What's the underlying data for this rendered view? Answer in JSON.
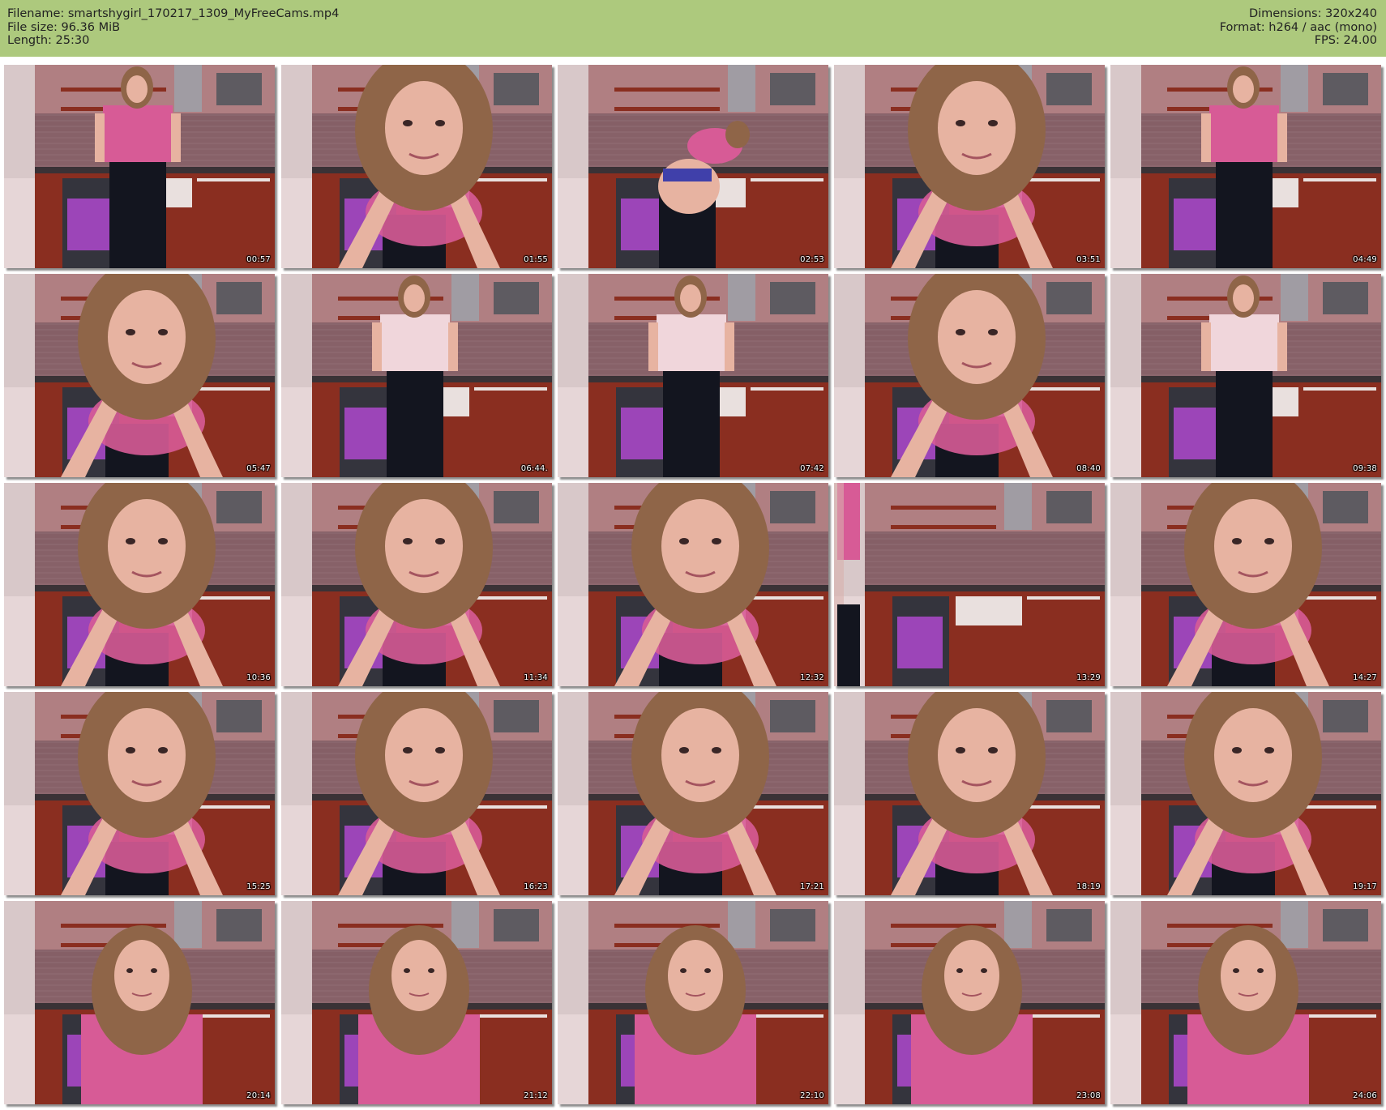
{
  "header": {
    "filename": "Filename: smartshygirl_170217_1309_MyFreeCams.mp4",
    "filesize": "File size: 96.36 MiB",
    "length": "Length: 25:30",
    "dimensions": "Dimensions: 320x240",
    "format": "Format: h264 / aac (mono)",
    "fps": "FPS: 24.00"
  },
  "thumbnails": [
    {
      "time": "00:57",
      "pose": "standing"
    },
    {
      "time": "01:55",
      "pose": "closeup"
    },
    {
      "time": "02:53",
      "pose": "bent"
    },
    {
      "time": "03:51",
      "pose": "closeup"
    },
    {
      "time": "04:49",
      "pose": "standing"
    },
    {
      "time": "05:47",
      "pose": "closeup"
    },
    {
      "time": "06:44.",
      "pose": "back"
    },
    {
      "time": "07:42",
      "pose": "back"
    },
    {
      "time": "08:40",
      "pose": "closeup"
    },
    {
      "time": "09:38",
      "pose": "back"
    },
    {
      "time": "10:36",
      "pose": "closeup"
    },
    {
      "time": "11:34",
      "pose": "closeup"
    },
    {
      "time": "12:32",
      "pose": "closeup"
    },
    {
      "time": "13:29",
      "pose": "empty"
    },
    {
      "time": "14:27",
      "pose": "closeup"
    },
    {
      "time": "15:25",
      "pose": "closeup"
    },
    {
      "time": "16:23",
      "pose": "closeup"
    },
    {
      "time": "17:21",
      "pose": "closeup"
    },
    {
      "time": "18:19",
      "pose": "closeup"
    },
    {
      "time": "19:17",
      "pose": "closeup"
    },
    {
      "time": "20:14",
      "pose": "seated"
    },
    {
      "time": "21:12",
      "pose": "seated"
    },
    {
      "time": "22:10",
      "pose": "seated"
    },
    {
      "time": "23:08",
      "pose": "seated"
    },
    {
      "time": "24:06",
      "pose": "seated"
    }
  ],
  "colors": {
    "header_bg": "#adc97d",
    "wall": "#b98b8d",
    "tile": "#7e5961",
    "cabinet": "#8a2e20",
    "towel": "#9c45b8",
    "shirt": "#d75b96",
    "hair": "#8f6548",
    "skin": "#e7b3a1",
    "pants": "#13151f"
  }
}
